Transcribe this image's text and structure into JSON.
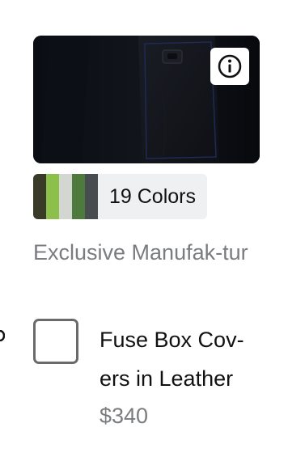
{
  "product": {
    "image_icon": "product-photo-fuse-box-cover",
    "info_icon": "info-icon",
    "colors_label": "19 Colors",
    "swatches": [
      "#3a3a28",
      "#8cc04a",
      "#d4d6d2",
      "#4f7a3e",
      "#474c51"
    ],
    "manufacturer": "Exclusive Manufak-tur",
    "name": "Fuse Box Cov-ers in Leather",
    "price": "$340"
  }
}
